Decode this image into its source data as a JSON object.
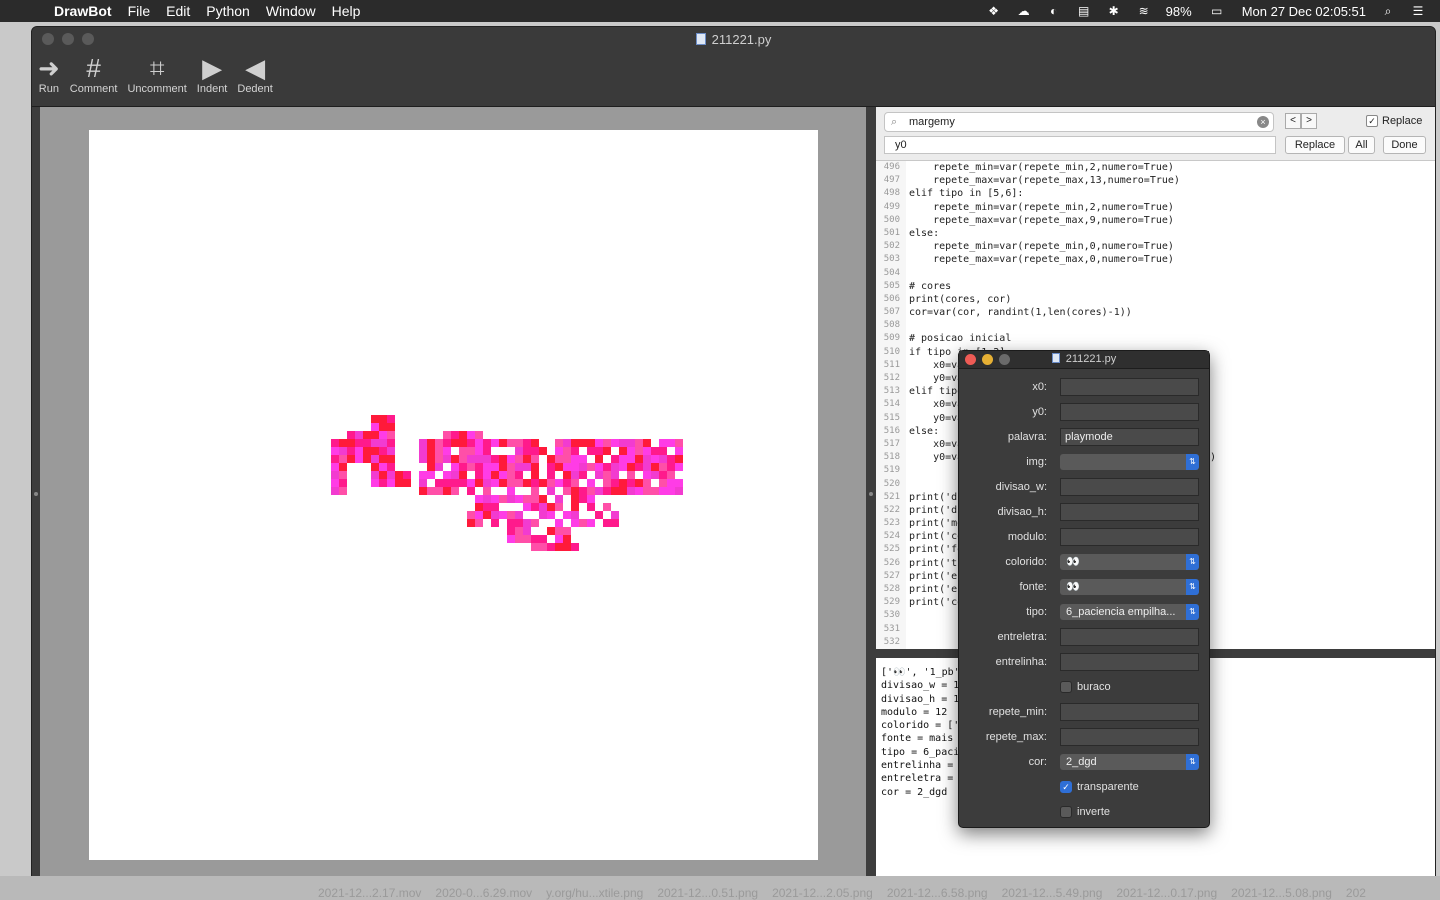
{
  "menubar": {
    "apple": "",
    "items": [
      "DrawBot",
      "File",
      "Edit",
      "Python",
      "Window",
      "Help"
    ],
    "battery": "98%",
    "clock": "Mon 27 Dec  02:05:51"
  },
  "window": {
    "title": "211221.py",
    "toolbar": [
      {
        "label": "Run",
        "icon": "run-arrow-icon",
        "glyph": "➜"
      },
      {
        "label": "Comment",
        "icon": "hash-icon",
        "glyph": "#"
      },
      {
        "label": "Uncomment",
        "icon": "uncomment-icon",
        "glyph": "⌗"
      },
      {
        "label": "Indent",
        "icon": "indent-icon",
        "glyph": "▶"
      },
      {
        "label": "Dedent",
        "icon": "dedent-icon",
        "glyph": "◀"
      }
    ]
  },
  "find": {
    "search_value": "margemy",
    "replace_value": "y0",
    "replace_label": "Replace",
    "replace_checked": true,
    "btn_replace": "Replace",
    "btn_all": "All",
    "btn_done": "Done"
  },
  "code": [
    {
      "n": "496",
      "t": "    repete_min=var(repete_min,2,numero=True)"
    },
    {
      "n": "497",
      "t": "    repete_max=var(repete_max,13,numero=True)"
    },
    {
      "n": "498",
      "t": "elif tipo in [5,6]:"
    },
    {
      "n": "499",
      "t": "    repete_min=var(repete_min,2,numero=True)"
    },
    {
      "n": "500",
      "t": "    repete_max=var(repete_max,9,numero=True)"
    },
    {
      "n": "501",
      "t": "else:"
    },
    {
      "n": "502",
      "t": "    repete_min=var(repete_min,0,numero=True)"
    },
    {
      "n": "503",
      "t": "    repete_max=var(repete_max,0,numero=True)"
    },
    {
      "n": "504",
      "t": ""
    },
    {
      "n": "505",
      "t": "# cores"
    },
    {
      "n": "506",
      "t": "print(cores, cor)"
    },
    {
      "n": "507",
      "t": "cor=var(cor, randint(1,len(cores)-1))"
    },
    {
      "n": "508",
      "t": ""
    },
    {
      "n": "509",
      "t": "# posicao inicial"
    },
    {
      "n": "510",
      "t": "if tipo in [1,2]:"
    },
    {
      "n": "511",
      "t": "    x0=va"
    },
    {
      "n": "512",
      "t": "    y0=va"
    },
    {
      "n": "513",
      "t": "elif tipo"
    },
    {
      "n": "514",
      "t": "    x0=va"
    },
    {
      "n": "515",
      "t": "    y0=va"
    },
    {
      "n": "516",
      "t": "else:"
    },
    {
      "n": "517",
      "t": "    x0=va"
    },
    {
      "n": "518",
      "t": "    y0=va                                        e)"
    },
    {
      "n": "519",
      "t": ""
    },
    {
      "n": "520",
      "t": ""
    },
    {
      "n": "521",
      "t": "print('di"
    },
    {
      "n": "522",
      "t": "print('di"
    },
    {
      "n": "523",
      "t": "print('mo"
    },
    {
      "n": "524",
      "t": "print('co"
    },
    {
      "n": "525",
      "t": "print('fo"
    },
    {
      "n": "526",
      "t": "print('ti"
    },
    {
      "n": "527",
      "t": "print('en"
    },
    {
      "n": "528",
      "t": "print('en"
    },
    {
      "n": "529",
      "t": "print('co"
    },
    {
      "n": "530",
      "t": ""
    },
    {
      "n": "531",
      "t": ""
    },
    {
      "n": "532",
      "t": ""
    }
  ],
  "output": [
    "['👀', '1_pb'",
    "divisao_w = 1",
    "divisao_h = 1",
    "modulo = 12",
    "colorido = ['",
    "fonte = mais",
    "tipo = 6_paci",
    "entrelinha =",
    "entreletra =",
    "cor = 2_dgd"
  ],
  "panel": {
    "title": "211221.py",
    "rows": [
      {
        "label": "x0:",
        "kind": "field",
        "value": ""
      },
      {
        "label": "y0:",
        "kind": "field",
        "value": ""
      },
      {
        "label": "palavra:",
        "kind": "field",
        "value": "playmode"
      },
      {
        "label": "img:",
        "kind": "select",
        "value": ""
      },
      {
        "label": "divisao_w:",
        "kind": "field",
        "value": ""
      },
      {
        "label": "divisao_h:",
        "kind": "field",
        "value": ""
      },
      {
        "label": "modulo:",
        "kind": "field",
        "value": ""
      },
      {
        "label": "colorido:",
        "kind": "select",
        "value": "👀"
      },
      {
        "label": "fonte:",
        "kind": "select",
        "value": "👀"
      },
      {
        "label": "tipo:",
        "kind": "select",
        "value": "6_paciencia empilha..."
      },
      {
        "label": "entreletra:",
        "kind": "field",
        "value": ""
      },
      {
        "label": "entrelinha:",
        "kind": "field",
        "value": ""
      },
      {
        "label": "",
        "kind": "check",
        "value": "buraco",
        "checked": false
      },
      {
        "label": "repete_min:",
        "kind": "field",
        "value": ""
      },
      {
        "label": "repete_max:",
        "kind": "field",
        "value": ""
      },
      {
        "label": "cor:",
        "kind": "select",
        "value": "2_dgd"
      },
      {
        "label": "",
        "kind": "check",
        "value": "transparente",
        "checked": true
      },
      {
        "label": "",
        "kind": "check",
        "value": "inverte",
        "checked": false
      }
    ]
  },
  "desktop_files": [
    "2021-12...2.17.mov",
    "2020-0...6.29.mov",
    "y.org/hu...xtile.png",
    "2021-12...0.51.png",
    "2021-12...2.05.png",
    "2021-12...6.58.png",
    "2021-12...5.49.png",
    "2021-12...0.17.png",
    "2021-12...5.08.png",
    "202"
  ],
  "colors": {
    "pink": "#ff1a8c",
    "magenta": "#ff3ce6",
    "red": "#ff1a3a",
    "accent": "#2f6fd6"
  }
}
